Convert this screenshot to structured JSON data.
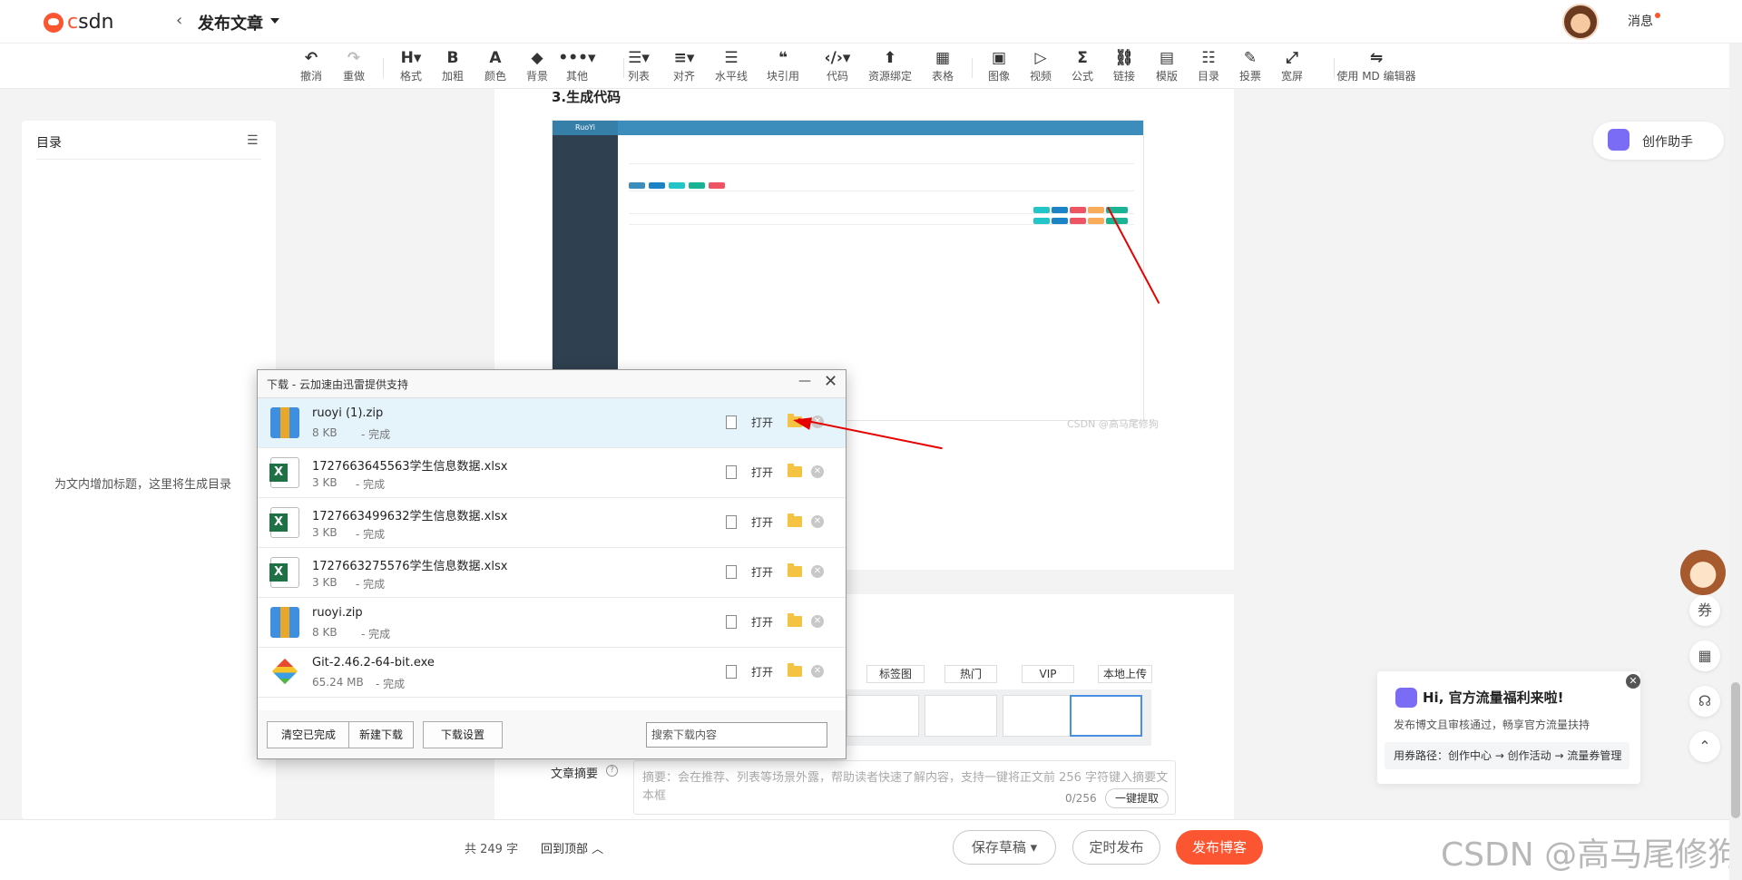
{
  "header": {
    "logo_text": "csdn",
    "back_glyph": "‹",
    "title": "发布文章",
    "messages_label": "消息"
  },
  "toolbar": {
    "items": [
      {
        "icon": "undo-icon",
        "glyph": "↶",
        "label": "撤消"
      },
      {
        "icon": "redo-icon",
        "glyph": "↷",
        "label": "重做"
      },
      {
        "icon": "heading-icon",
        "glyph": "H▾",
        "label": "格式"
      },
      {
        "icon": "bold-icon",
        "glyph": "B",
        "label": "加粗"
      },
      {
        "icon": "font-color-icon",
        "glyph": "A",
        "label": "颜色"
      },
      {
        "icon": "fill-color-icon",
        "glyph": "◆",
        "label": "背景"
      },
      {
        "icon": "more-icon",
        "glyph": "•••▾",
        "label": "其他"
      },
      {
        "icon": "list-icon",
        "glyph": "☰▾",
        "label": "列表"
      },
      {
        "icon": "align-icon",
        "glyph": "≡▾",
        "label": "对齐"
      },
      {
        "icon": "hr-icon",
        "glyph": "☰",
        "label": "水平线"
      },
      {
        "icon": "quote-icon",
        "glyph": "❝",
        "label": "块引用"
      },
      {
        "icon": "code-icon",
        "glyph": "‹/›▾",
        "label": "代码"
      },
      {
        "icon": "resource-icon",
        "glyph": "⬆",
        "label": "资源绑定"
      },
      {
        "icon": "table-icon",
        "glyph": "▦",
        "label": "表格"
      },
      {
        "icon": "image-icon",
        "glyph": "▣",
        "label": "图像"
      },
      {
        "icon": "video-icon",
        "glyph": "▷",
        "label": "视频"
      },
      {
        "icon": "formula-icon",
        "glyph": "Σ",
        "label": "公式"
      },
      {
        "icon": "link-icon",
        "glyph": "⛓",
        "label": "链接"
      },
      {
        "icon": "template-icon",
        "glyph": "▤",
        "label": "模版"
      },
      {
        "icon": "toc-icon",
        "glyph": "☷",
        "label": "目录"
      },
      {
        "icon": "vote-icon",
        "glyph": "✎",
        "label": "投票"
      },
      {
        "icon": "wide-screen-icon",
        "glyph": "⤢",
        "label": "宽屏"
      },
      {
        "icon": "md-editor-icon",
        "glyph": "⇋",
        "label": "使用 MD 编辑器"
      }
    ]
  },
  "toc": {
    "title": "目录",
    "empty_text": "为文内增加标题，这里将生成目录"
  },
  "article": {
    "heading": "3.生成代码",
    "image_watermark": "CSDN @高马尾修狗"
  },
  "settings": {
    "tags": [
      "标签图",
      "热门",
      "VIP",
      "本地上传"
    ],
    "abstract_label": "文章摘要",
    "abstract_help": "?",
    "abstract_placeholder": "摘要：会在推荐、列表等场景外露，帮助读者快速了解内容，支持一键将正文前 256 字符键入摘要文本框",
    "abstract_count": "0/256",
    "extract_button": "一键提取"
  },
  "bottom": {
    "word_count": "共 249 字",
    "back_to_top": "回到顶部",
    "save_draft": "保存草稿",
    "schedule": "定时发布",
    "publish": "发布博客",
    "watermark": "CSDN @高马尾修狗"
  },
  "right_panel": {
    "assistant_label": "创作助手",
    "promo_title": "Hi, 官方流量福利来啦!",
    "promo_sub": "发布博文且审核通过，畅享官方流量扶持",
    "promo_route": "用券路径：创作中心 → 创作活动 → 流量券管理",
    "promo_close": "✕"
  },
  "download_dialog": {
    "title": "下载 - 云加速由迅雷提供支持",
    "minimize_glyph": "—",
    "close_glyph": "✕",
    "open_label": "打开",
    "items": [
      {
        "name": "ruoyi (1).zip",
        "size": "8 KB",
        "status": "- 完成",
        "type": "zip"
      },
      {
        "name": "1727663645563学生信息数据.xlsx",
        "size": "3 KB",
        "status": "- 完成",
        "type": "xls"
      },
      {
        "name": "1727663499632学生信息数据.xlsx",
        "size": "3 KB",
        "status": "- 完成",
        "type": "xls"
      },
      {
        "name": "1727663275576学生信息数据.xlsx",
        "size": "3 KB",
        "status": "- 完成",
        "type": "xls"
      },
      {
        "name": "ruoyi.zip",
        "size": "8 KB",
        "status": "- 完成",
        "type": "zip"
      },
      {
        "name": "Git-2.46.2-64-bit.exe",
        "size": "65.24 MB",
        "status": "- 完成",
        "type": "git"
      }
    ],
    "buttons": {
      "clear_done": "清空已完成",
      "new_download": "新建下载",
      "settings": "下载设置"
    },
    "search_placeholder": "搜索下载内容"
  },
  "colors": {
    "brand": "#fc5531",
    "annotation_arrow": "#e60000",
    "selected_row": "#e5f3fb"
  }
}
